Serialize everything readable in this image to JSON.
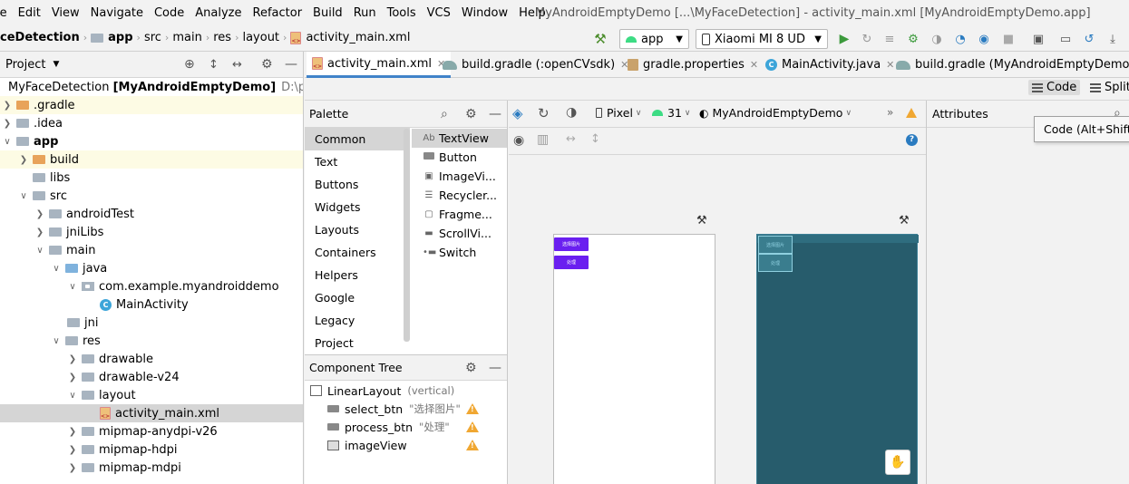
{
  "window": {
    "title": "MyAndroidEmptyDemo [...\\MyFaceDetection] - activity_main.xml [MyAndroidEmptyDemo.app]"
  },
  "menu": [
    "le",
    "Edit",
    "View",
    "Navigate",
    "Code",
    "Analyze",
    "Refactor",
    "Build",
    "Run",
    "Tools",
    "VCS",
    "Window",
    "Help"
  ],
  "breadcrumb": [
    "ceDetection",
    "app",
    "src",
    "main",
    "res",
    "layout",
    "activity_main.xml"
  ],
  "toolbar": {
    "run_config": "app",
    "device": "Xiaomi MI 8 UD"
  },
  "project_panel": {
    "title": "Project",
    "root_name": "MyFaceDetection",
    "root_module": "[MyAndroidEmptyDemo]",
    "root_path": "D:\\progr",
    "tree": [
      "MyFaceDetection",
      ".gradle",
      ".idea",
      "app",
      "build",
      "libs",
      "src",
      "androidTest",
      "jniLibs",
      "main",
      "java",
      "com.example.myandroiddemo",
      "MainActivity",
      "jni",
      "res",
      "drawable",
      "drawable-v24",
      "layout",
      "activity_main.xml",
      "mipmap-anydpi-v26",
      "mipmap-hdpi",
      "mipmap-mdpi"
    ]
  },
  "editor_tabs": [
    "activity_main.xml",
    "build.gradle (:openCVsdk)",
    "gradle.properties",
    "MainActivity.java",
    "build.gradle (MyAndroidEmptyDemo)"
  ],
  "view_modes": {
    "code": "Code",
    "split": "Split"
  },
  "palette": {
    "title": "Palette",
    "categories": [
      "Common",
      "Text",
      "Buttons",
      "Widgets",
      "Layouts",
      "Containers",
      "Helpers",
      "Google",
      "Legacy",
      "Project"
    ],
    "widgets": [
      {
        "icon": "Ab",
        "label": "TextView"
      },
      {
        "icon": "btn",
        "label": "Button"
      },
      {
        "icon": "img",
        "label": "ImageVi..."
      },
      {
        "icon": "list",
        "label": "Recycler..."
      },
      {
        "icon": "frag",
        "label": "Fragme..."
      },
      {
        "icon": "scroll",
        "label": "ScrollVi..."
      },
      {
        "icon": "switch",
        "label": "Switch"
      }
    ]
  },
  "design_toolbar": {
    "device": "Pixel",
    "api": "31",
    "theme": "MyAndroidEmptyDemo"
  },
  "component_tree": {
    "title": "Component Tree",
    "root": {
      "label": "LinearLayout",
      "hint": "(vertical)"
    },
    "children": [
      {
        "label": "select_btn",
        "hint": "\"选择图片\""
      },
      {
        "label": "process_btn",
        "hint": "\"处理\""
      },
      {
        "label": "imageView",
        "hint": ""
      }
    ]
  },
  "attributes": {
    "title": "Attributes",
    "tooltip": "Code (Alt+Shift+"
  }
}
